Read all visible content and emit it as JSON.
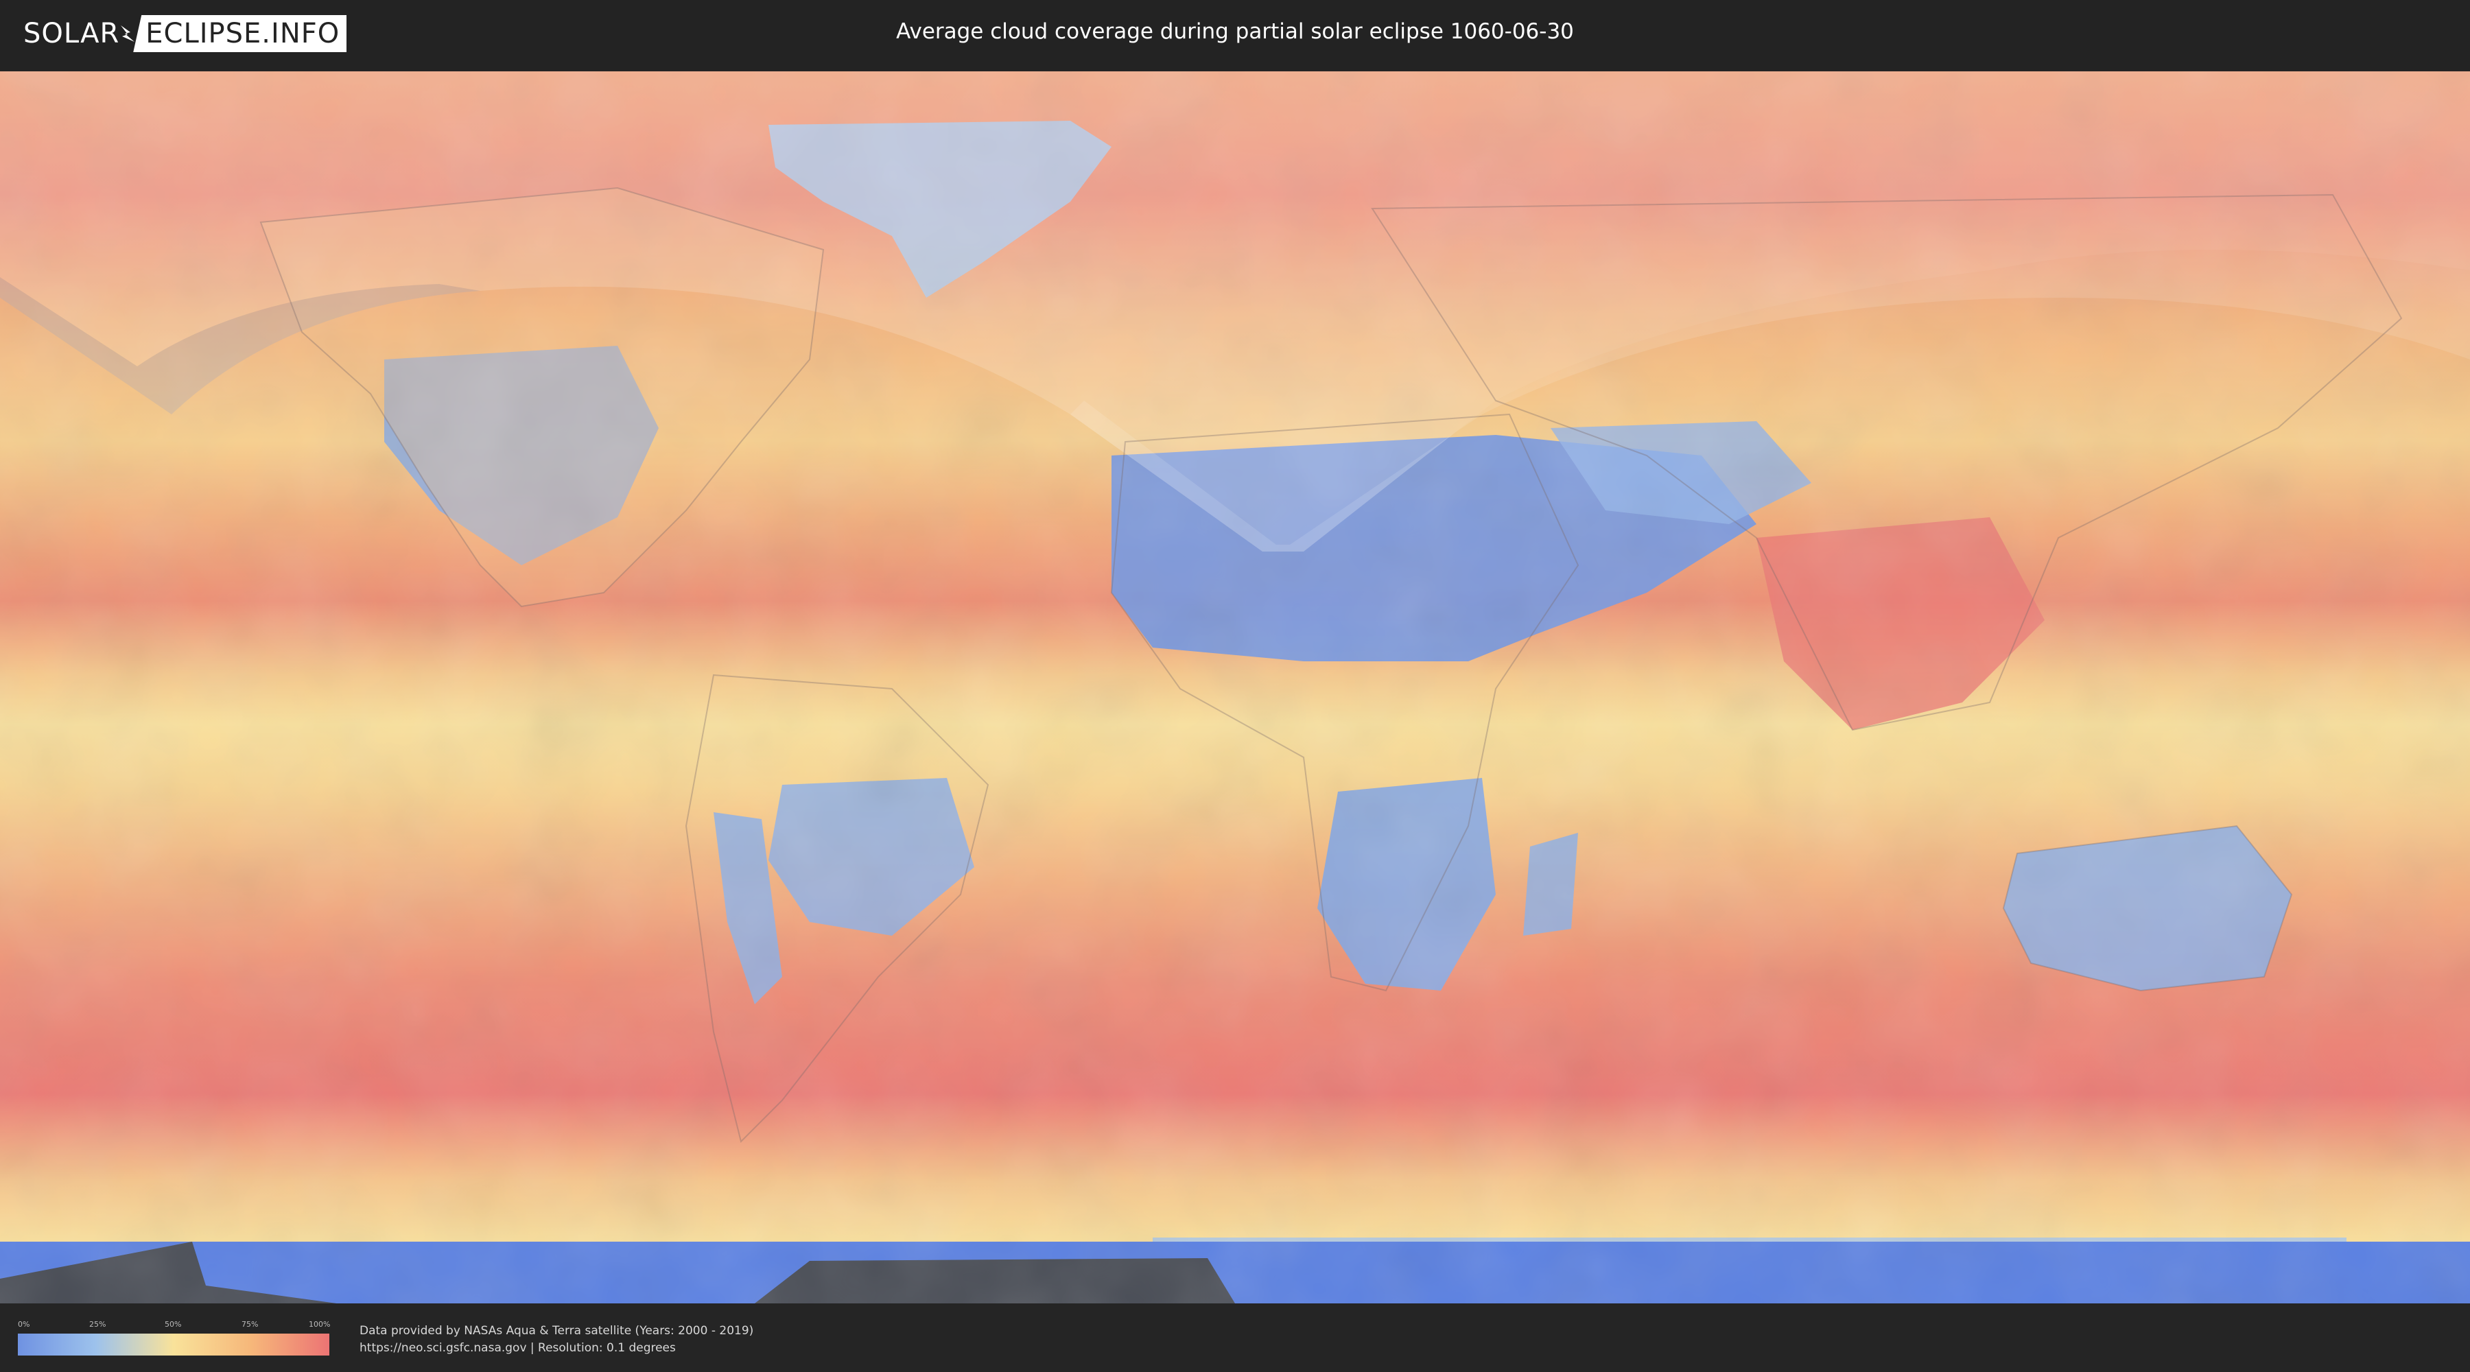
{
  "header": {
    "logo_part1": "SOLAR",
    "logo_part2": "ECLIPSE.INFO",
    "title": "Average cloud coverage during partial solar eclipse 1060-06-30"
  },
  "legend": {
    "ticks": [
      "0%",
      "25%",
      "50%",
      "75%",
      "100%"
    ],
    "colors": [
      "#6f92e2",
      "#9dc2ec",
      "#f9e29a",
      "#f6b77a",
      "#ec7474"
    ]
  },
  "credits": {
    "line1": "Data provided by NASAs Aqua & Terra satellite (Years: 2000 - 2019)",
    "line2": "https://neo.sci.gsfc.nasa.gov | Resolution: 0.1 degrees"
  },
  "map": {
    "colors": {
      "clear": "#7396e0",
      "low": "#a6c7ea",
      "mid": "#f8df9b",
      "high": "#f5aa79",
      "overcast": "#eb7774",
      "antarctic_blue": "#5a80e2",
      "dark_ground": "#464646"
    }
  }
}
